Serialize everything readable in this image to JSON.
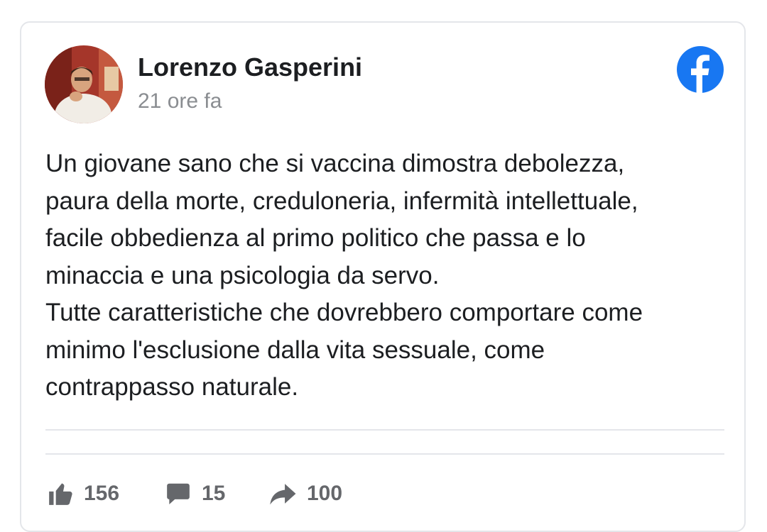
{
  "post": {
    "author": "Lorenzo Gasperini",
    "time": "21 ore fa",
    "avatar_icon": "profile-photo",
    "platform_icon": "facebook-icon",
    "brand_color": "#1877f2",
    "text_lines": [
      "Un giovane sano che si vaccina dimostra debolezza,",
      "paura della morte, creduloneria, infermità intellettuale,",
      "facile obbedienza al primo politico che passa e lo",
      "minaccia e una psicologia da servo.",
      "Tutte caratteristiche che dovrebbero comportare come",
      "minimo l'esclusione dalla vita sessuale, come",
      "contrappasso naturale."
    ]
  },
  "stats": {
    "likes": "156",
    "comments": "15",
    "shares": "100"
  }
}
